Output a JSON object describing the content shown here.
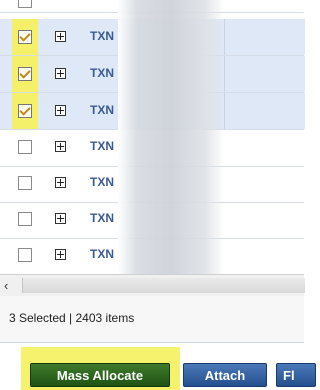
{
  "grid": {
    "rows": [
      {
        "checked": true,
        "id": "TXN"
      },
      {
        "checked": true,
        "id": "TXN"
      },
      {
        "checked": true,
        "id": "TXN"
      },
      {
        "checked": false,
        "id": "TXN"
      },
      {
        "checked": false,
        "id": "TXN"
      },
      {
        "checked": false,
        "id": "TXN"
      },
      {
        "checked": false,
        "id": "TXN"
      }
    ]
  },
  "scrollbar": {
    "left_arrow": "‹"
  },
  "status": {
    "text": "3 Selected | 2403 items"
  },
  "toolbar": {
    "mass_allocate_label": "Mass Allocate",
    "attach_label": "Attach",
    "third_label": "Fl"
  },
  "colors": {
    "highlight": "#f4f06a",
    "selected_row": "#dfe8f6",
    "link_text": "#3a5a93",
    "green_button": "#2d6a1f",
    "blue_button": "#2f5c9c"
  }
}
